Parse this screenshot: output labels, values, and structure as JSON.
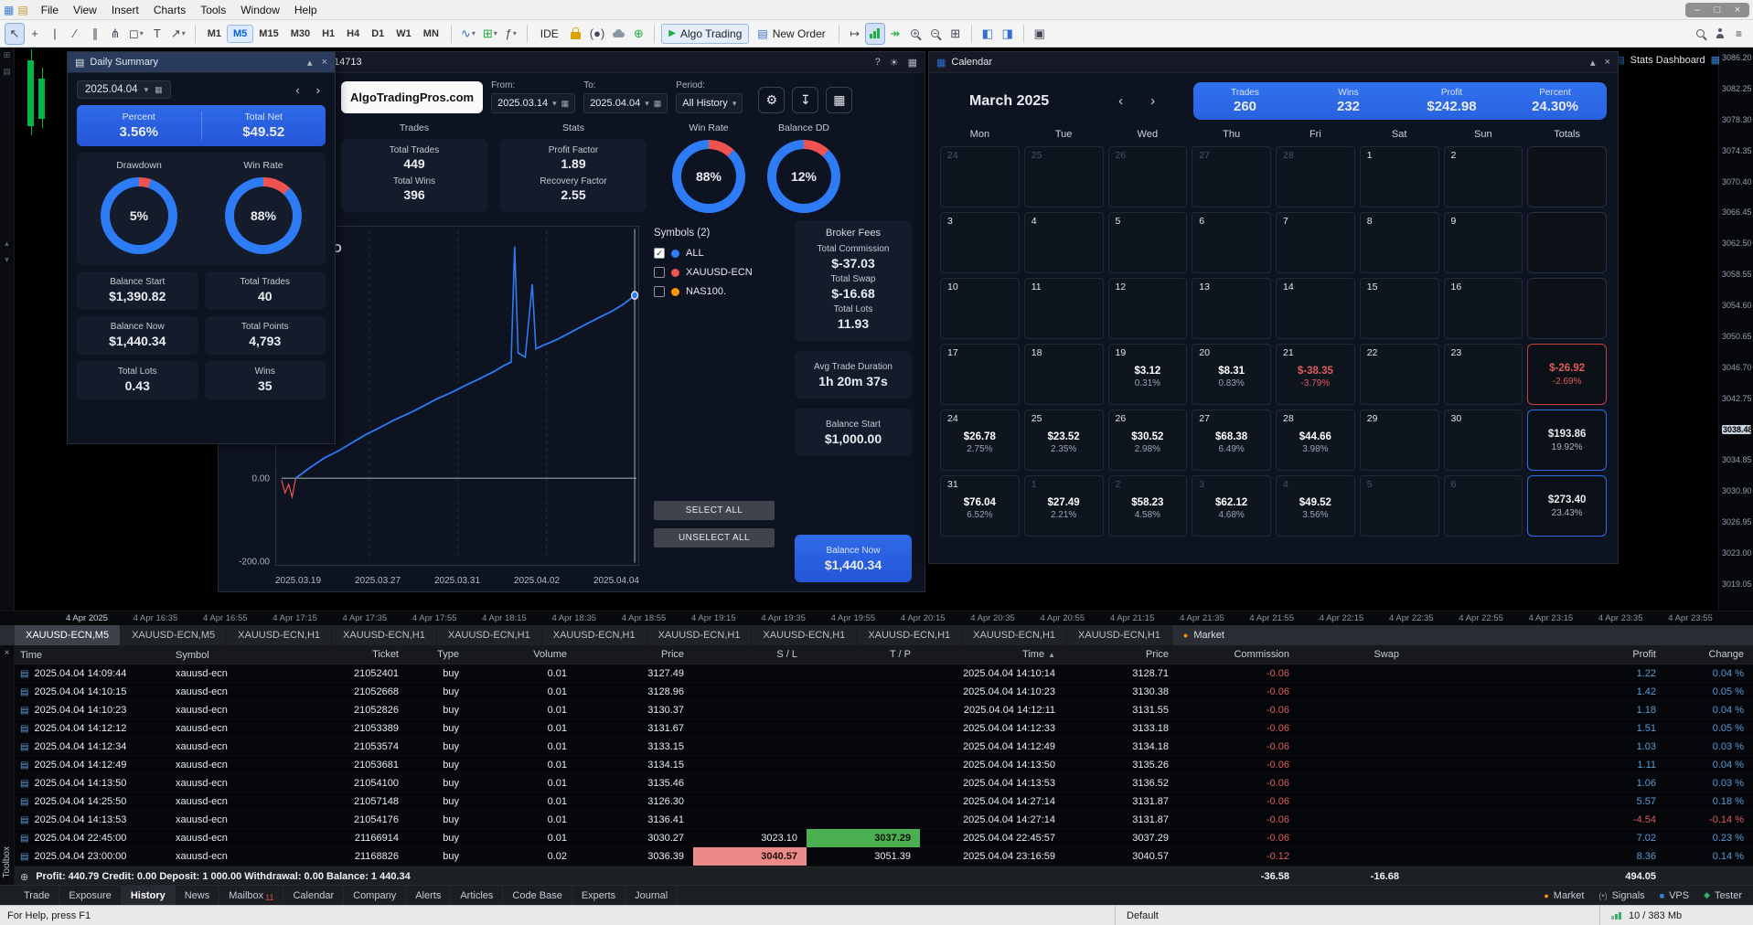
{
  "colors": {
    "blue": "#2e7bf6",
    "red": "#ef5350",
    "green": "#4caf50",
    "orange": "#ff9800"
  },
  "icons": {
    "app_chart": "▦",
    "app_list": "▤",
    "minimize": "–",
    "maximize": "□",
    "close": "×",
    "cursor": "↖",
    "crosshair": "+",
    "vline": "|",
    "trendline": "∕",
    "channel": "∥",
    "pitchfork": "⋔",
    "shapes": "◻",
    "caret_down": "▾",
    "text_tool": "T",
    "arrow_tool": "↗",
    "line_chart": "∿",
    "grid": "⊞",
    "function": "ƒ",
    "signal": "(●)",
    "globe": "⊕",
    "play": "▶",
    "document": "▤",
    "shift_right": "↦",
    "autoshift": "↠",
    "tile": "⊞",
    "panel_left": "◧",
    "panel_right": "◨",
    "camera": "▣",
    "hamburger": "≡",
    "question": "?",
    "sun": "☀",
    "calendar": "▦",
    "gear": "⚙",
    "export": "↧",
    "collapse": "▴",
    "chevron_left": "‹",
    "chevron_right": "›",
    "check": "✓",
    "sort_asc": "▲",
    "plus_circle": "⊕",
    "doc_row": "▤",
    "market_dot": "●",
    "vps_square": "■",
    "tester_diamond": "◆",
    "signals_paren": "(•)",
    "close_small": "×"
  },
  "menu": {
    "items": [
      "File",
      "View",
      "Insert",
      "Charts",
      "Tools",
      "Window",
      "Help"
    ]
  },
  "toolbar": {
    "timeframes": [
      "M1",
      "M5",
      "M15",
      "M30",
      "H1",
      "H4",
      "D1",
      "W1",
      "MN"
    ],
    "active_timeframe": "M5",
    "ide": "IDE",
    "algo_trading": "Algo Trading",
    "new_order": "New Order"
  },
  "stats_dashboard_label": "Stats Dashboard",
  "toolbox_label": "Toolbox",
  "daily_summary": {
    "title": "Daily Summary",
    "date": "2025.04.04",
    "highlight": {
      "left_label": "Percent",
      "left_value": "3.56%",
      "right_label": "Total Net",
      "right_value": "$49.52"
    },
    "donuts": [
      {
        "label": "Drawdown",
        "value": "5%",
        "red_pct": 5
      },
      {
        "label": "Win Rate",
        "value": "88%",
        "red_pct": 12
      }
    ],
    "cells": [
      {
        "label": "Balance Start",
        "value": "$1,390.82"
      },
      {
        "label": "Total Trades",
        "value": "40"
      },
      {
        "label": "Balance Now",
        "value": "$1,440.34"
      },
      {
        "label": "Total Points",
        "value": "4,793"
      },
      {
        "label": "Total Lots",
        "value": "0.43"
      },
      {
        "label": "Wins",
        "value": "35"
      }
    ]
  },
  "dashboard": {
    "title": "14713",
    "brand": "AlgoTradingPros.com",
    "filters": {
      "from_label": "From:",
      "from": "2025.03.14",
      "to_label": "To:",
      "to": "2025.04.04",
      "period_label": "Period:",
      "period": "All History"
    },
    "cards": {
      "trades_header": "Trades",
      "trades": [
        {
          "label": "Total Trades",
          "value": "449"
        },
        {
          "label": "Total Wins",
          "value": "396"
        }
      ],
      "stats_header": "Stats",
      "stats": [
        {
          "label": "Profit Factor",
          "value": "1.89"
        },
        {
          "label": "Recovery Factor",
          "value": "2.55"
        }
      ]
    },
    "donuts": [
      {
        "label": "Win Rate",
        "value": "88%",
        "red_pct": 12
      },
      {
        "label": "Balance DD",
        "value": "12%",
        "red_pct": 12
      }
    ],
    "symbols_header": "Symbols (2)",
    "symbols": [
      {
        "label": "ALL",
        "checked": true,
        "color": "#2e7bf6"
      },
      {
        "label": "XAUUSD-ECN",
        "checked": false,
        "color": "#ef5350"
      },
      {
        "label": "NAS100.",
        "checked": false,
        "color": "#ff9800"
      }
    ],
    "select_all": "SELECT ALL",
    "unselect_all": "UNSELECT ALL",
    "side": [
      {
        "header": "Broker Fees",
        "rows": [
          {
            "label": "Total Commission",
            "value": "$-37.03"
          },
          {
            "label": "Total Swap",
            "value": "$-16.68"
          },
          {
            "label": "Total Lots",
            "value": "11.93"
          }
        ]
      },
      {
        "rows": [
          {
            "label": "Avg Trade Duration",
            "value": "1h 20m 37s"
          }
        ]
      },
      {
        "rows": [
          {
            "label": "Balance Start",
            "value": "$1,000.00"
          }
        ]
      },
      {
        "blue": true,
        "rows": [
          {
            "label": "Balance Now",
            "value": "$1,440.34"
          }
        ]
      }
    ]
  },
  "chart_data": {
    "type": "line",
    "title": "ALFRED",
    "x_ticks": [
      "2025.03.19",
      "2025.03.27",
      "2025.03.31",
      "2025.04.02",
      "2025.04.04"
    ],
    "y_ticks": [
      {
        "label": "0.00",
        "value": 0
      },
      {
        "label": "-200.00",
        "value": -200
      }
    ],
    "ylim": [
      -200,
      620
    ],
    "grid": "dashed-vertical",
    "legend_position": "right",
    "start_dip": [
      [
        0,
        -5
      ],
      [
        1,
        -35
      ],
      [
        2,
        -15
      ],
      [
        3,
        -45
      ],
      [
        4,
        0
      ]
    ],
    "series": [
      {
        "name": "ALL",
        "color": "#2e7bf6",
        "points": [
          [
            4,
            0
          ],
          [
            8,
            25
          ],
          [
            12,
            48
          ],
          [
            16,
            65
          ],
          [
            20,
            85
          ],
          [
            24,
            105
          ],
          [
            28,
            122
          ],
          [
            32,
            140
          ],
          [
            36,
            155
          ],
          [
            40,
            172
          ],
          [
            44,
            190
          ],
          [
            48,
            205
          ],
          [
            52,
            222
          ],
          [
            56,
            238
          ],
          [
            60,
            255
          ],
          [
            63,
            270
          ],
          [
            65,
            278
          ],
          [
            66,
            555
          ],
          [
            67,
            300
          ],
          [
            69,
            290
          ],
          [
            71,
            465
          ],
          [
            72,
            310
          ],
          [
            74,
            318
          ],
          [
            78,
            332
          ],
          [
            82,
            350
          ],
          [
            86,
            368
          ],
          [
            90,
            385
          ],
          [
            94,
            402
          ],
          [
            97,
            418
          ],
          [
            100,
            438
          ]
        ]
      }
    ]
  },
  "calendar": {
    "title": "Calendar",
    "month": "March 2025",
    "summary": [
      {
        "label": "Trades",
        "value": "260"
      },
      {
        "label": "Wins",
        "value": "232"
      },
      {
        "label": "Profit",
        "value": "$242.98"
      },
      {
        "label": "Percent",
        "value": "24.30%"
      }
    ],
    "day_headers": [
      "Mon",
      "Tue",
      "Wed",
      "Thu",
      "Fri",
      "Sat",
      "Sun",
      "Totals"
    ],
    "weeks": [
      {
        "days": [
          {
            "num": "24",
            "dim": true
          },
          {
            "num": "25",
            "dim": true
          },
          {
            "num": "26",
            "dim": true
          },
          {
            "num": "27",
            "dim": true
          },
          {
            "num": "28",
            "dim": true
          },
          {
            "num": "1"
          },
          {
            "num": "2"
          }
        ],
        "total": {}
      },
      {
        "days": [
          {
            "num": "3"
          },
          {
            "num": "4"
          },
          {
            "num": "5"
          },
          {
            "num": "6"
          },
          {
            "num": "7"
          },
          {
            "num": "8"
          },
          {
            "num": "9"
          }
        ],
        "total": {}
      },
      {
        "days": [
          {
            "num": "10"
          },
          {
            "num": "11"
          },
          {
            "num": "12"
          },
          {
            "num": "13"
          },
          {
            "num": "14"
          },
          {
            "num": "15"
          },
          {
            "num": "16"
          }
        ],
        "total": {}
      },
      {
        "days": [
          {
            "num": "17"
          },
          {
            "num": "18"
          },
          {
            "num": "19",
            "profit": "$3.12",
            "percent": "0.31%"
          },
          {
            "num": "20",
            "profit": "$8.31",
            "percent": "0.83%"
          },
          {
            "num": "21",
            "profit": "$-38.35",
            "percent": "-3.79%",
            "negative": true
          },
          {
            "num": "22"
          },
          {
            "num": "23"
          }
        ],
        "total": {
          "profit": "$-26.92",
          "percent": "-2.69%",
          "style": "red"
        }
      },
      {
        "days": [
          {
            "num": "24",
            "profit": "$26.78",
            "percent": "2.75%"
          },
          {
            "num": "25",
            "profit": "$23.52",
            "percent": "2.35%"
          },
          {
            "num": "26",
            "profit": "$30.52",
            "percent": "2.98%"
          },
          {
            "num": "27",
            "profit": "$68.38",
            "percent": "6.49%"
          },
          {
            "num": "28",
            "profit": "$44.66",
            "percent": "3.98%"
          },
          {
            "num": "29"
          },
          {
            "num": "30"
          }
        ],
        "total": {
          "profit": "$193.86",
          "percent": "19.92%",
          "style": "blue"
        }
      },
      {
        "days": [
          {
            "num": "31",
            "profit": "$76.04",
            "percent": "6.52%"
          },
          {
            "num": "1",
            "dim": true,
            "profit": "$27.49",
            "percent": "2.21%"
          },
          {
            "num": "2",
            "dim": true,
            "profit": "$58.23",
            "percent": "4.58%"
          },
          {
            "num": "3",
            "dim": true,
            "profit": "$62.12",
            "percent": "4.68%"
          },
          {
            "num": "4",
            "dim": true,
            "profit": "$49.52",
            "percent": "3.56%"
          },
          {
            "num": "5",
            "dim": true
          },
          {
            "num": "6",
            "dim": true
          }
        ],
        "total": {
          "profit": "$273.40",
          "percent": "23.43%",
          "style": "blue"
        }
      }
    ]
  },
  "price_axis": {
    "ticks": [
      "3086.20",
      "3082.25",
      "3078.30",
      "3074.35",
      "3070.40",
      "3066.45",
      "3062.50",
      "3058.55",
      "3054.60",
      "3050.65",
      "3046.70",
      "3042.75",
      "3038.48",
      "3034.85",
      "3030.90",
      "3026.95",
      "3023.00",
      "3019.05"
    ],
    "current": "3038.48"
  },
  "time_axis": [
    "4 Apr 2025",
    "4 Apr 16:35",
    "4 Apr 16:55",
    "4 Apr 17:15",
    "4 Apr 17:35",
    "4 Apr 17:55",
    "4 Apr 18:15",
    "4 Apr 18:35",
    "4 Apr 18:55",
    "4 Apr 19:15",
    "4 Apr 19:35",
    "4 Apr 19:55",
    "4 Apr 20:15",
    "4 Apr 20:35",
    "4 Apr 20:55",
    "4 Apr 21:15",
    "4 Apr 21:35",
    "4 Apr 21:55",
    "4 Apr 22:15",
    "4 Apr 22:35",
    "4 Apr 22:55",
    "4 Apr 23:15",
    "4 Apr 23:35",
    "4 Apr 23:55"
  ],
  "chart_tabs": {
    "tabs": [
      "XAUUSD-ECN,M5",
      "XAUUSD-ECN,M5",
      "XAUUSD-ECN,H1",
      "XAUUSD-ECN,H1",
      "XAUUSD-ECN,H1",
      "XAUUSD-ECN,H1",
      "XAUUSD-ECN,H1",
      "XAUUSD-ECN,H1",
      "XAUUSD-ECN,H1",
      "XAUUSD-ECN,H1",
      "XAUUSD-ECN,H1"
    ],
    "active_index": 0,
    "market_tab": "Market"
  },
  "history": {
    "columns": [
      "Time",
      "Symbol",
      "Ticket",
      "Type",
      "Volume",
      "Price",
      "S / L",
      "T / P",
      "Time",
      "Price",
      "Commission",
      "Swap",
      "Profit",
      "Change"
    ],
    "sort_column_index": 8,
    "rows": [
      {
        "time": "2025.04.04 14:09:44",
        "symbol": "xauusd-ecn",
        "ticket": "21052401",
        "type": "buy",
        "volume": "0.01",
        "price": "3127.49",
        "sl": "",
        "tp": "",
        "time2": "2025.04.04 14:10:14",
        "price2": "3128.71",
        "commission": "-0.06",
        "swap": "",
        "profit": "1.22",
        "change": "0.04 %"
      },
      {
        "time": "2025.04.04 14:10:15",
        "symbol": "xauusd-ecn",
        "ticket": "21052668",
        "type": "buy",
        "volume": "0.01",
        "price": "3128.96",
        "sl": "",
        "tp": "",
        "time2": "2025.04.04 14:10:23",
        "price2": "3130.38",
        "commission": "-0.06",
        "swap": "",
        "profit": "1.42",
        "change": "0.05 %"
      },
      {
        "time": "2025.04.04 14:10:23",
        "symbol": "xauusd-ecn",
        "ticket": "21052826",
        "type": "buy",
        "volume": "0.01",
        "price": "3130.37",
        "sl": "",
        "tp": "",
        "time2": "2025.04.04 14:12:11",
        "price2": "3131.55",
        "commission": "-0.06",
        "swap": "",
        "profit": "1.18",
        "change": "0.04 %"
      },
      {
        "time": "2025.04.04 14:12:12",
        "symbol": "xauusd-ecn",
        "ticket": "21053389",
        "type": "buy",
        "volume": "0.01",
        "price": "3131.67",
        "sl": "",
        "tp": "",
        "time2": "2025.04.04 14:12:33",
        "price2": "3133.18",
        "commission": "-0.06",
        "swap": "",
        "profit": "1.51",
        "change": "0.05 %"
      },
      {
        "time": "2025.04.04 14:12:34",
        "symbol": "xauusd-ecn",
        "ticket": "21053574",
        "type": "buy",
        "volume": "0.01",
        "price": "3133.15",
        "sl": "",
        "tp": "",
        "time2": "2025.04.04 14:12:49",
        "price2": "3134.18",
        "commission": "-0.06",
        "swap": "",
        "profit": "1.03",
        "change": "0.03 %"
      },
      {
        "time": "2025.04.04 14:12:49",
        "symbol": "xauusd-ecn",
        "ticket": "21053681",
        "type": "buy",
        "volume": "0.01",
        "price": "3134.15",
        "sl": "",
        "tp": "",
        "time2": "2025.04.04 14:13:50",
        "price2": "3135.26",
        "commission": "-0.06",
        "swap": "",
        "profit": "1.11",
        "change": "0.04 %"
      },
      {
        "time": "2025.04.04 14:13:50",
        "symbol": "xauusd-ecn",
        "ticket": "21054100",
        "type": "buy",
        "volume": "0.01",
        "price": "3135.46",
        "sl": "",
        "tp": "",
        "time2": "2025.04.04 14:13:53",
        "price2": "3136.52",
        "commission": "-0.06",
        "swap": "",
        "profit": "1.06",
        "change": "0.03 %"
      },
      {
        "time": "2025.04.04 14:25:50",
        "symbol": "xauusd-ecn",
        "ticket": "21057148",
        "type": "buy",
        "volume": "0.01",
        "price": "3126.30",
        "sl": "",
        "tp": "",
        "time2": "2025.04.04 14:27:14",
        "price2": "3131.87",
        "commission": "-0.06",
        "swap": "",
        "profit": "5.57",
        "change": "0.18 %"
      },
      {
        "time": "2025.04.04 14:13:53",
        "symbol": "xauusd-ecn",
        "ticket": "21054176",
        "type": "buy",
        "volume": "0.01",
        "price": "3136.41",
        "sl": "",
        "tp": "",
        "time2": "2025.04.04 14:27:14",
        "price2": "3131.87",
        "commission": "-0.06",
        "swap": "",
        "profit": "-4.54",
        "change": "-0.14 %"
      },
      {
        "time": "2025.04.04 22:45:00",
        "symbol": "xauusd-ecn",
        "ticket": "21166914",
        "type": "buy",
        "volume": "0.01",
        "price": "3030.27",
        "sl": "3023.10",
        "tp": "3037.29",
        "tp_hit": true,
        "time2": "2025.04.04 22:45:57",
        "price2": "3037.29",
        "commission": "-0.06",
        "swap": "",
        "profit": "7.02",
        "change": "0.23 %"
      },
      {
        "time": "2025.04.04 23:00:00",
        "symbol": "xauusd-ecn",
        "ticket": "21168826",
        "type": "buy",
        "volume": "0.02",
        "price": "3036.39",
        "sl": "3040.57",
        "sl_hit": true,
        "tp": "3051.39",
        "time2": "2025.04.04 23:16:59",
        "price2": "3040.57",
        "commission": "-0.12",
        "swap": "",
        "profit": "8.36",
        "change": "0.14 %"
      }
    ],
    "footer": {
      "summary": "Profit: 440.79   Credit: 0.00   Deposit: 1 000.00   Withdrawal: 0.00   Balance: 1 440.34",
      "commission": "-36.58",
      "swap": "-16.68",
      "profit": "494.05"
    }
  },
  "bottom_tabs": {
    "tabs": [
      "Trade",
      "Exposure",
      "History",
      "News",
      "Mailbox",
      "Calendar",
      "Company",
      "Alerts",
      "Articles",
      "Code Base",
      "Experts",
      "Journal"
    ],
    "active": "History",
    "mailbox_badge": "11",
    "right": [
      {
        "label": "Market"
      },
      {
        "label": "Signals"
      },
      {
        "label": "VPS"
      },
      {
        "label": "Tester"
      }
    ]
  },
  "statusbar": {
    "help": "For Help, press F1",
    "profile": "Default",
    "memory": "10 / 383 Mb"
  }
}
